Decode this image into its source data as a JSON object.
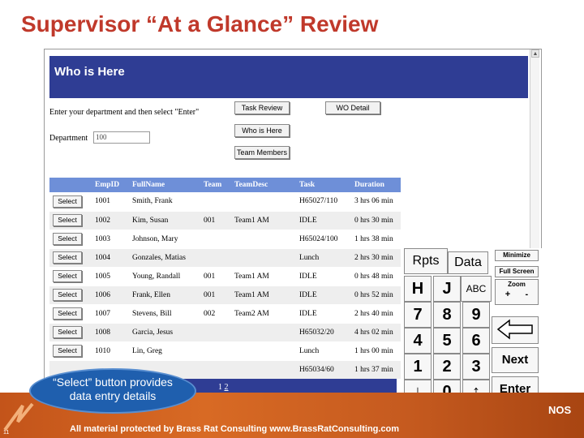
{
  "slide_title": "Supervisor “At a Glance” Review",
  "app": {
    "header_title": "Who is Here",
    "prompt": "Enter your department and then select \"Enter\"",
    "department_label": "Department",
    "department_value": "100",
    "buttons": {
      "task_review": "Task Review",
      "wo_detail": "WO Detail",
      "who_is_here": "Who is Here",
      "team_members": "Team Members"
    }
  },
  "table": {
    "columns": [
      "",
      "EmpID",
      "FullName",
      "Team",
      "TeamDesc",
      "Task",
      "Duration"
    ],
    "select_label": "Select",
    "rows": [
      {
        "emp_id": "1001",
        "full_name": "Smith, Frank",
        "team": "",
        "team_desc": "",
        "task": "H65027/110",
        "duration": "3 hrs 06 min"
      },
      {
        "emp_id": "1002",
        "full_name": "Kim, Susan",
        "team": "001",
        "team_desc": "Team1 AM",
        "task": "IDLE",
        "duration": "0 hrs 30 min"
      },
      {
        "emp_id": "1003",
        "full_name": "Johnson, Mary",
        "team": "",
        "team_desc": "",
        "task": "H65024/100",
        "duration": "1 hrs 38 min"
      },
      {
        "emp_id": "1004",
        "full_name": "Gonzales, Matias",
        "team": "",
        "team_desc": "",
        "task": "Lunch",
        "duration": "2 hrs 30 min"
      },
      {
        "emp_id": "1005",
        "full_name": "Young, Randall",
        "team": "001",
        "team_desc": "Team1 AM",
        "task": "IDLE",
        "duration": "0 hrs 48 min"
      },
      {
        "emp_id": "1006",
        "full_name": "Frank, Ellen",
        "team": "001",
        "team_desc": "Team1 AM",
        "task": "IDLE",
        "duration": "0 hrs 52 min"
      },
      {
        "emp_id": "1007",
        "full_name": "Stevens, Bill",
        "team": "002",
        "team_desc": "Team2 AM",
        "task": "IDLE",
        "duration": "2 hrs 40 min"
      },
      {
        "emp_id": "1008",
        "full_name": "Garcia, Jesus",
        "team": "",
        "team_desc": "",
        "task": "H65032/20",
        "duration": "4 hrs 02 min"
      },
      {
        "emp_id": "1010",
        "full_name": "Lin, Greg",
        "team": "",
        "team_desc": "",
        "task": "Lunch",
        "duration": "1 hrs 00 min"
      },
      {
        "emp_id": "",
        "full_name": "",
        "team": "",
        "team_desc": "",
        "task": "H65034/60",
        "duration": "1 hrs 37 min"
      }
    ],
    "pager": {
      "page1": "1",
      "page2": "2"
    }
  },
  "keypad": {
    "rpts": "Rpts",
    "data": "Data",
    "minimize": "Minimize",
    "full_screen": "Full Screen",
    "zoom": "Zoom",
    "zoom_in": "+",
    "zoom_out": "-",
    "h": "H",
    "j": "J",
    "abc": "ABC",
    "k7": "7",
    "k8": "8",
    "k9": "9",
    "k4": "4",
    "k5": "5",
    "k6": "6",
    "k1": "1",
    "k2": "2",
    "k3": "3",
    "k0": "0",
    "next": "Next",
    "enter": "Enter",
    "down_arrow": "↓",
    "up_arrow": "↑"
  },
  "callout": {
    "line1": "“Select” button provides",
    "line2": "data entry details"
  },
  "footer": {
    "text": "All material protected by Brass Rat Consulting www.BrassRatConsulting.com",
    "page_number": "11",
    "brand": "NOS"
  },
  "colors": {
    "title": "#c0392b",
    "app_header": "#2f3d94",
    "table_header": "#6e8fd8",
    "footer": "#d86a24",
    "callout": "#1f5fae"
  }
}
